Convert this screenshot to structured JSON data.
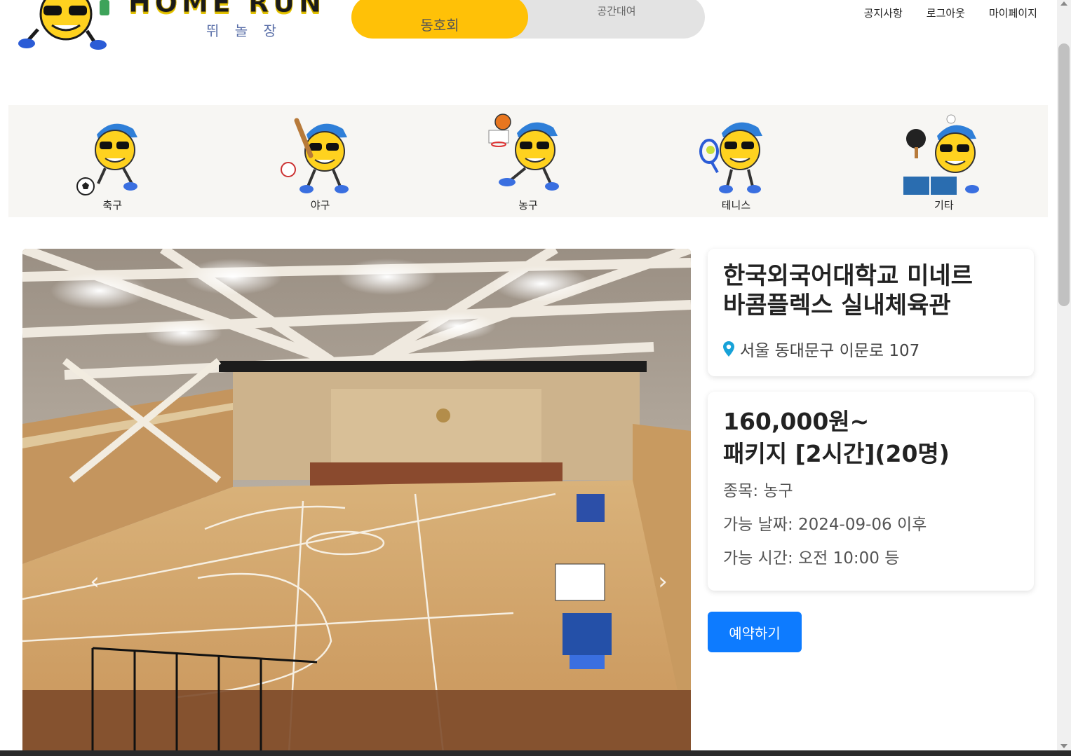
{
  "header": {
    "logo_text": "HOME RUN",
    "logo_sub": "뛰 놀 장",
    "toggle": {
      "active": "동호회",
      "inactive": "공간대여"
    },
    "nav": [
      "공지사항",
      "로그아웃",
      "마이페이지"
    ]
  },
  "categories": [
    {
      "label": "축구",
      "icon": "soccer-mascot"
    },
    {
      "label": "야구",
      "icon": "baseball-mascot"
    },
    {
      "label": "농구",
      "icon": "basketball-mascot"
    },
    {
      "label": "테니스",
      "icon": "tennis-mascot"
    },
    {
      "label": "기타",
      "icon": "pingpong-mascot"
    }
  ],
  "carousel": {
    "prev": "‹",
    "next": "›"
  },
  "venue": {
    "name_line1": "한국외국어대학교 미네르",
    "name_line2": "바콤플렉스 실내체육관",
    "address": "서울 동대문구 이문로 107"
  },
  "pricing": {
    "price": "160,000원~",
    "package": "패키지 [2시간](20명)",
    "sport": "종목: 농구",
    "date": "가능 날짜: 2024-09-06 이후",
    "time": "가능 시간: 오전 10:00 등"
  },
  "reserve_label": "예약하기",
  "colors": {
    "accent": "#ffc107",
    "primary": "#0d7bff",
    "strip": "#f7f6f3"
  }
}
